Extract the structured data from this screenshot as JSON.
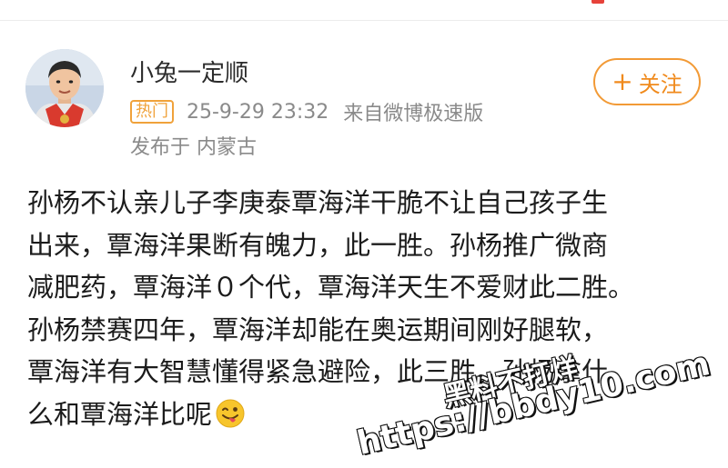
{
  "post": {
    "author": "小兔一定顺",
    "hot_badge": "热门",
    "timestamp": "25-9-29 23:32",
    "source": "来自微博极速版",
    "location": "发布于 内蒙古",
    "follow_label": "关注",
    "content_lines": [
      "孙杨不认亲儿子李庚泰覃海洋干脆不让自己孩子生",
      "出来，覃海洋果断有魄力，此一胜。孙杨推广微商",
      "减肥药，覃海洋０个代，覃海洋天生不爱财此二胜。",
      "孙杨禁赛四年，覃海洋却能在奥运期间刚好腿软，",
      "覃海洋有大智慧懂得紧急避险，此三胜。孙杨拿什",
      "么和覃海洋比呢"
    ],
    "emoji": "tongue-wink-emoji"
  },
  "watermark": {
    "line1": "黑料不打烊",
    "line2": "https://bbdy10.com"
  },
  "colors": {
    "accent_orange": "#f29a36",
    "meta_gray": "#8a8a8a",
    "text": "#1b1b1b"
  }
}
